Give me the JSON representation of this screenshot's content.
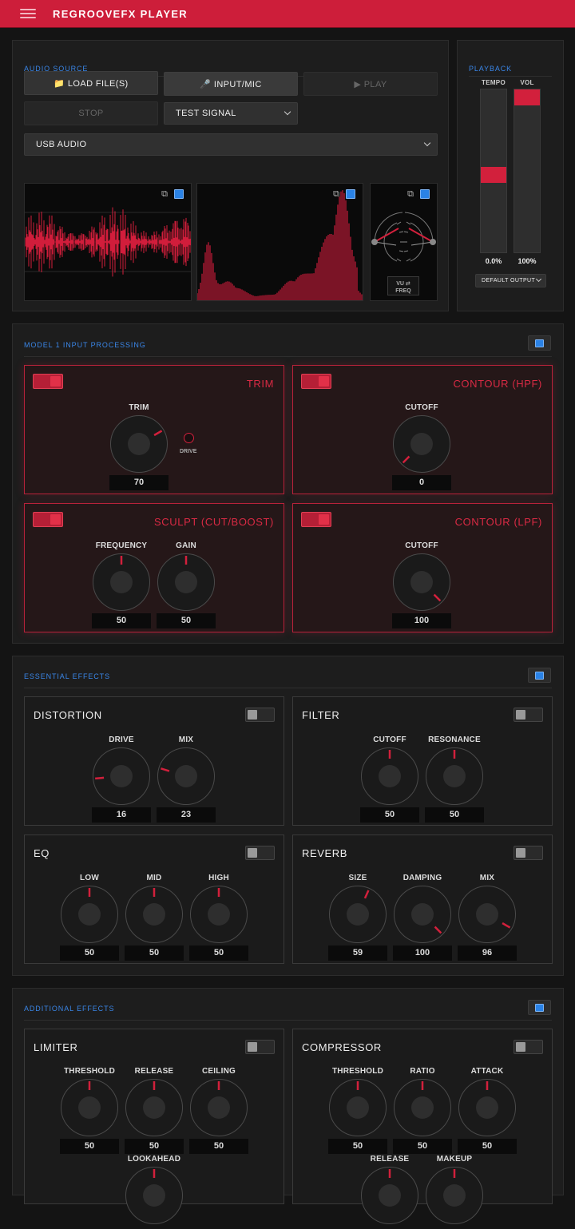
{
  "app": {
    "title": "REGROOVEFX PLAYER"
  },
  "audio_source": {
    "title": "AUDIO SOURCE",
    "load_label": "📁 LOAD FILE(S)",
    "input_label": "🎤 INPUT/MIC",
    "play_label": "▶ PLAY",
    "stop_label": "STOP",
    "source_select": "TEST SIGNAL",
    "device_select": "USB AUDIO",
    "vu_toggle_label": "VU ⇄ FREQ"
  },
  "playback": {
    "title": "PLAYBACK",
    "tempo_label": "TEMPO",
    "vol_label": "VOL",
    "tempo_value": "0.0%",
    "vol_value": "100%",
    "tempo_level": 0.52,
    "vol_level": 0.0,
    "output_select": "DEFAULT OUTPUT"
  },
  "model1": {
    "title": "MODEL 1 INPUT PROCESSING",
    "trim": {
      "title": "TRIM",
      "knob_label": "TRIM",
      "value": "70",
      "drive_label": "DRIVE"
    },
    "hpf": {
      "title": "CONTOUR (HPF)",
      "knob_label": "CUTOFF",
      "value": "0"
    },
    "sculpt": {
      "title": "SCULPT (CUT/BOOST)",
      "freq_label": "FREQUENCY",
      "freq_value": "50",
      "gain_label": "GAIN",
      "gain_value": "50"
    },
    "lpf": {
      "title": "CONTOUR (LPF)",
      "knob_label": "CUTOFF",
      "value": "100"
    }
  },
  "essential": {
    "title": "ESSENTIAL EFFECTS",
    "distortion": {
      "title": "DISTORTION",
      "drive_label": "DRIVE",
      "drive_value": "16",
      "mix_label": "MIX",
      "mix_value": "23"
    },
    "filter": {
      "title": "FILTER",
      "cutoff_label": "CUTOFF",
      "cutoff_value": "50",
      "res_label": "RESONANCE",
      "res_value": "50"
    },
    "eq": {
      "title": "EQ",
      "low_label": "LOW",
      "low_value": "50",
      "mid_label": "MID",
      "mid_value": "50",
      "high_label": "HIGH",
      "high_value": "50"
    },
    "reverb": {
      "title": "REVERB",
      "size_label": "SIZE",
      "size_value": "59",
      "damping_label": "DAMPING",
      "damping_value": "100",
      "mix_label": "MIX",
      "mix_value": "96"
    }
  },
  "additional": {
    "title": "ADDITIONAL EFFECTS",
    "limiter": {
      "title": "LIMITER",
      "threshold_label": "THRESHOLD",
      "threshold_value": "50",
      "release_label": "RELEASE",
      "release_value": "50",
      "ceiling_label": "CEILING",
      "ceiling_value": "50",
      "lookahead_label": "LOOKAHEAD"
    },
    "compressor": {
      "title": "COMPRESSOR",
      "threshold_label": "THRESHOLD",
      "threshold_value": "50",
      "ratio_label": "RATIO",
      "ratio_value": "50",
      "attack_label": "ATTACK",
      "attack_value": "50",
      "release_label": "RELEASE",
      "makeup_label": "MAKEUP"
    }
  },
  "colors": {
    "accent": "#cd1e3a",
    "blue": "#3a86e8"
  },
  "icons": [
    "menu-icon",
    "popout-icon",
    "fullscreen-icon",
    "chevron-down-icon"
  ]
}
